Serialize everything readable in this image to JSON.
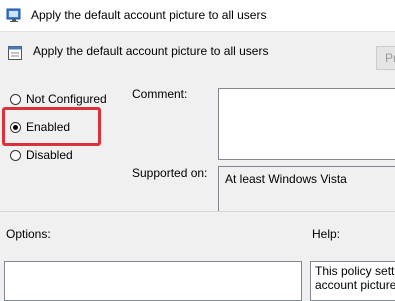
{
  "window": {
    "title": "Apply the default account picture to all users"
  },
  "header": {
    "policy_name": "Apply the default account picture to all users",
    "previous_button": "Pr"
  },
  "state": {
    "options": [
      {
        "label": "Not Configured",
        "checked": false
      },
      {
        "label": "Enabled",
        "checked": true
      },
      {
        "label": "Disabled",
        "checked": false
      }
    ],
    "highlight_color": "#d9323b"
  },
  "comment": {
    "label": "Comment:",
    "value": ""
  },
  "supported": {
    "label": "Supported on:",
    "value": "At least Windows Vista"
  },
  "options_section": {
    "label": "Options:"
  },
  "help_section": {
    "label": "Help:",
    "text": "This policy sett\naccount picture"
  }
}
